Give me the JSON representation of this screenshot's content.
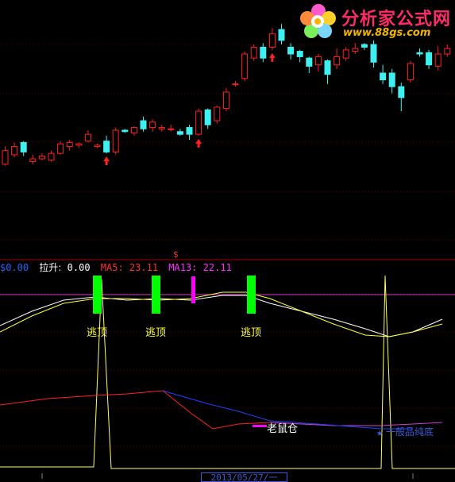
{
  "logo": {
    "main": "分析家公式网",
    "sub": "www.88gs.com",
    "icon": "flower-icon"
  },
  "indicators": {
    "dollar_marker": "$",
    "first": {
      "label": "$0.00",
      "color": "#1e64ff"
    },
    "lasheng": {
      "label": "拉升:",
      "value": "0.00",
      "color": "#ffffff"
    },
    "ma5": {
      "label": "MA5:",
      "value": "23.11",
      "color": "#ff3030"
    },
    "ma13": {
      "label": "MA13:",
      "value": "22.11",
      "color": "#ff30ff"
    }
  },
  "annotations": {
    "escape_top": "逃顶",
    "rat_position": "老鼠仓",
    "hint_text": "一般品纯底"
  },
  "footer": {
    "date": "2013/05/27/一"
  },
  "colors": {
    "up": "#ff2020",
    "down": "#40f0f0",
    "signal_green": "#00ff00",
    "signal_magenta": "#ff00ff",
    "grid": "#5a0000"
  },
  "chart_data": {
    "type": "candlestick",
    "candles": [
      {
        "o": 31,
        "c": 41,
        "h": 44,
        "l": 30
      },
      {
        "o": 38,
        "c": 44,
        "h": 47,
        "l": 36
      },
      {
        "o": 47,
        "c": 40,
        "h": 48,
        "l": 37
      },
      {
        "o": 33,
        "c": 35,
        "h": 38,
        "l": 31
      },
      {
        "o": 35,
        "c": 37,
        "h": 39,
        "l": 34
      },
      {
        "o": 34,
        "c": 39,
        "h": 41,
        "l": 33
      },
      {
        "o": 39,
        "c": 46,
        "h": 48,
        "l": 38
      },
      {
        "o": 44,
        "c": 47,
        "h": 49,
        "l": 41
      },
      {
        "o": 45,
        "c": 46,
        "h": 47,
        "l": 43
      },
      {
        "o": 48,
        "c": 53,
        "h": 56,
        "l": 47
      },
      {
        "o": 44,
        "c": 45,
        "h": 46,
        "l": 43
      },
      {
        "o": 48,
        "c": 40,
        "h": 52,
        "l": 39
      },
      {
        "o": 40,
        "c": 56,
        "h": 58,
        "l": 38
      },
      {
        "o": 56,
        "c": 55,
        "h": 57,
        "l": 54
      },
      {
        "o": 54,
        "c": 58,
        "h": 59,
        "l": 52
      },
      {
        "o": 63,
        "c": 57,
        "h": 66,
        "l": 55
      },
      {
        "o": 58,
        "c": 62,
        "h": 64,
        "l": 55
      },
      {
        "o": 57,
        "c": 58,
        "h": 60,
        "l": 55
      },
      {
        "o": 57,
        "c": 57,
        "h": 60,
        "l": 55
      },
      {
        "o": 55,
        "c": 53,
        "h": 57,
        "l": 52
      },
      {
        "o": 58,
        "c": 53,
        "h": 60,
        "l": 49
      },
      {
        "o": 53,
        "c": 70,
        "h": 72,
        "l": 52
      },
      {
        "o": 71,
        "c": 60,
        "h": 72,
        "l": 57
      },
      {
        "o": 63,
        "c": 73,
        "h": 74,
        "l": 61
      },
      {
        "o": 72,
        "c": 84,
        "h": 87,
        "l": 70
      },
      {
        "o": 90,
        "c": 90,
        "h": 92,
        "l": 88
      },
      {
        "o": 94,
        "c": 112,
        "h": 114,
        "l": 92
      },
      {
        "o": 109,
        "c": 117,
        "h": 119,
        "l": 107
      },
      {
        "o": 117,
        "c": 109,
        "h": 120,
        "l": 106
      },
      {
        "o": 117,
        "c": 127,
        "h": 131,
        "l": 115
      },
      {
        "o": 130,
        "c": 122,
        "h": 134,
        "l": 119
      },
      {
        "o": 117,
        "c": 112,
        "h": 120,
        "l": 108
      },
      {
        "o": 114,
        "c": 110,
        "h": 115,
        "l": 106
      },
      {
        "o": 109,
        "c": 103,
        "h": 110,
        "l": 98
      },
      {
        "o": 104,
        "c": 110,
        "h": 112,
        "l": 99
      },
      {
        "o": 107,
        "c": 97,
        "h": 108,
        "l": 90
      },
      {
        "o": 104,
        "c": 110,
        "h": 116,
        "l": 101
      },
      {
        "o": 109,
        "c": 115,
        "h": 117,
        "l": 107
      },
      {
        "o": 114,
        "c": 116,
        "h": 120,
        "l": 112
      },
      {
        "o": 119,
        "c": 117,
        "h": 120,
        "l": 115
      },
      {
        "o": 119,
        "c": 106,
        "h": 122,
        "l": 102
      },
      {
        "o": 98,
        "c": 93,
        "h": 104,
        "l": 90
      },
      {
        "o": 98,
        "c": 88,
        "h": 101,
        "l": 83
      },
      {
        "o": 88,
        "c": 80,
        "h": 91,
        "l": 70
      },
      {
        "o": 93,
        "c": 105,
        "h": 107,
        "l": 91
      },
      {
        "o": 113,
        "c": 112,
        "h": 116,
        "l": 110
      },
      {
        "o": 113,
        "c": 104,
        "h": 115,
        "l": 101
      },
      {
        "o": 103,
        "c": 112,
        "h": 118,
        "l": 100
      },
      {
        "o": 112,
        "c": 116,
        "h": 119,
        "l": 110
      }
    ],
    "up_arrows_at": [
      11,
      21,
      29
    ],
    "escape_top_signals_at": [
      11,
      18,
      30
    ],
    "rat_signal_at": [
      23
    ],
    "lower_pane_lines": 5
  }
}
